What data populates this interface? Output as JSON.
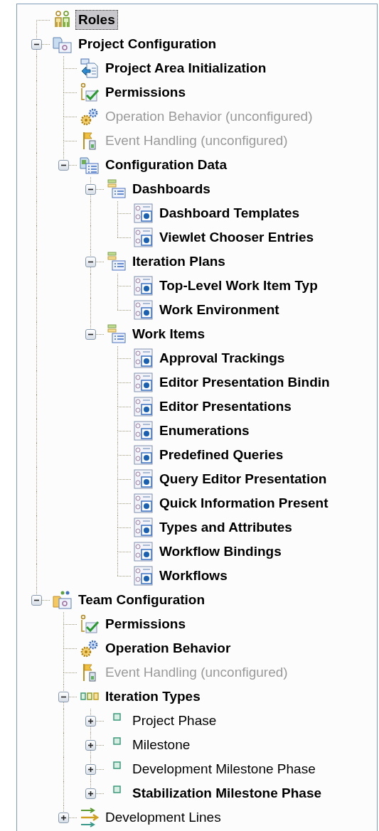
{
  "tree": {
    "nodes": [
      {
        "label": "Roles",
        "kind": "roles",
        "bold": true,
        "disabled": false,
        "selected": true
      },
      {
        "label": "Project Configuration",
        "kind": "project-config",
        "bold": true,
        "disabled": false,
        "selected": false,
        "expanded": true,
        "children": [
          {
            "label": "Project Area Initialization",
            "kind": "initialization",
            "bold": true,
            "disabled": false,
            "selected": false
          },
          {
            "label": "Permissions",
            "kind": "permissions",
            "bold": true,
            "disabled": false,
            "selected": false
          },
          {
            "label": "Operation Behavior (unconfigured)",
            "kind": "operation",
            "bold": false,
            "disabled": true,
            "selected": false
          },
          {
            "label": "Event Handling (unconfigured)",
            "kind": "event",
            "bold": false,
            "disabled": true,
            "selected": false
          },
          {
            "label": "Configuration Data",
            "kind": "config-data",
            "bold": true,
            "disabled": false,
            "selected": false,
            "expanded": true,
            "children": [
              {
                "label": "Dashboards",
                "kind": "category",
                "bold": true,
                "disabled": false,
                "selected": false,
                "expanded": true,
                "children": [
                  {
                    "label": "Dashboard Templates",
                    "kind": "data",
                    "bold": true,
                    "disabled": false,
                    "selected": false
                  },
                  {
                    "label": "Viewlet Chooser Entries",
                    "kind": "data",
                    "bold": true,
                    "disabled": false,
                    "selected": false
                  }
                ]
              },
              {
                "label": "Iteration Plans",
                "kind": "category",
                "bold": true,
                "disabled": false,
                "selected": false,
                "expanded": true,
                "children": [
                  {
                    "label": "Top-Level Work Item Typ",
                    "kind": "data",
                    "bold": true,
                    "disabled": false,
                    "selected": false
                  },
                  {
                    "label": "Work Environment",
                    "kind": "data",
                    "bold": true,
                    "disabled": false,
                    "selected": false
                  }
                ]
              },
              {
                "label": "Work Items",
                "kind": "category",
                "bold": true,
                "disabled": false,
                "selected": false,
                "expanded": true,
                "children": [
                  {
                    "label": "Approval Trackings",
                    "kind": "data",
                    "bold": true,
                    "disabled": false,
                    "selected": false
                  },
                  {
                    "label": "Editor Presentation Bindin",
                    "kind": "data",
                    "bold": true,
                    "disabled": false,
                    "selected": false
                  },
                  {
                    "label": "Editor Presentations",
                    "kind": "data",
                    "bold": true,
                    "disabled": false,
                    "selected": false
                  },
                  {
                    "label": "Enumerations",
                    "kind": "data",
                    "bold": true,
                    "disabled": false,
                    "selected": false
                  },
                  {
                    "label": "Predefined Queries",
                    "kind": "data",
                    "bold": true,
                    "disabled": false,
                    "selected": false
                  },
                  {
                    "label": "Query Editor Presentation",
                    "kind": "data",
                    "bold": true,
                    "disabled": false,
                    "selected": false
                  },
                  {
                    "label": "Quick Information Present",
                    "kind": "data",
                    "bold": true,
                    "disabled": false,
                    "selected": false
                  },
                  {
                    "label": "Types and Attributes",
                    "kind": "data",
                    "bold": true,
                    "disabled": false,
                    "selected": false
                  },
                  {
                    "label": "Workflow Bindings",
                    "kind": "data",
                    "bold": true,
                    "disabled": false,
                    "selected": false
                  },
                  {
                    "label": "Workflows",
                    "kind": "data",
                    "bold": true,
                    "disabled": false,
                    "selected": false
                  }
                ]
              }
            ]
          }
        ]
      },
      {
        "label": "Team Configuration",
        "kind": "team-config",
        "bold": true,
        "disabled": false,
        "selected": false,
        "expanded": true,
        "children": [
          {
            "label": "Permissions",
            "kind": "permissions",
            "bold": true,
            "disabled": false,
            "selected": false
          },
          {
            "label": "Operation Behavior",
            "kind": "operation",
            "bold": true,
            "disabled": false,
            "selected": false
          },
          {
            "label": "Event Handling (unconfigured)",
            "kind": "event",
            "bold": false,
            "disabled": true,
            "selected": false
          },
          {
            "label": "Iteration Types",
            "kind": "iteration-types",
            "bold": true,
            "disabled": false,
            "selected": false,
            "expanded": true,
            "children": [
              {
                "label": "Project Phase",
                "kind": "iteration",
                "bold": false,
                "disabled": false,
                "selected": false,
                "expanded": false
              },
              {
                "label": "Milestone",
                "kind": "iteration",
                "bold": false,
                "disabled": false,
                "selected": false,
                "expanded": false
              },
              {
                "label": "Development Milestone Phase",
                "kind": "iteration",
                "bold": false,
                "disabled": false,
                "selected": false,
                "expanded": false
              },
              {
                "label": "Stabilization Milestone Phase",
                "kind": "iteration",
                "bold": true,
                "disabled": false,
                "selected": false,
                "expanded": false
              }
            ]
          },
          {
            "label": "Development Lines",
            "kind": "dev-lines",
            "bold": false,
            "disabled": false,
            "selected": false,
            "expanded": false
          }
        ]
      }
    ]
  }
}
